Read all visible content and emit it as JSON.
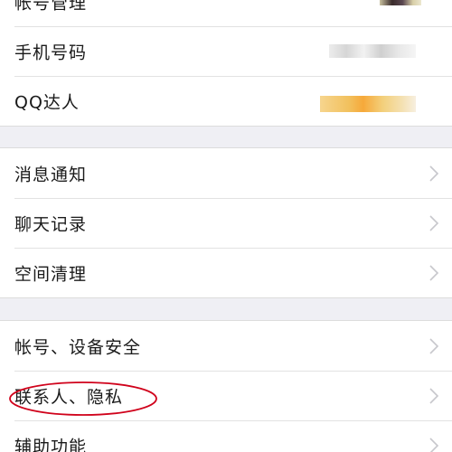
{
  "group1": {
    "items": [
      {
        "label": "帐号管理"
      },
      {
        "label": "手机号码"
      },
      {
        "label": "QQ达人"
      }
    ]
  },
  "group2": {
    "items": [
      {
        "label": "消息通知"
      },
      {
        "label": "聊天记录"
      },
      {
        "label": "空间清理"
      }
    ]
  },
  "group3": {
    "items": [
      {
        "label": "帐号、设备安全"
      },
      {
        "label": "联系人、隐私"
      },
      {
        "label": "辅助功能"
      }
    ]
  },
  "colors": {
    "background": "#efeff4",
    "row_background": "#ffffff",
    "chevron": "#c7c7cc",
    "annotation_circle": "#d0021b"
  },
  "icons": {
    "chevron": "chevron-right-icon"
  }
}
